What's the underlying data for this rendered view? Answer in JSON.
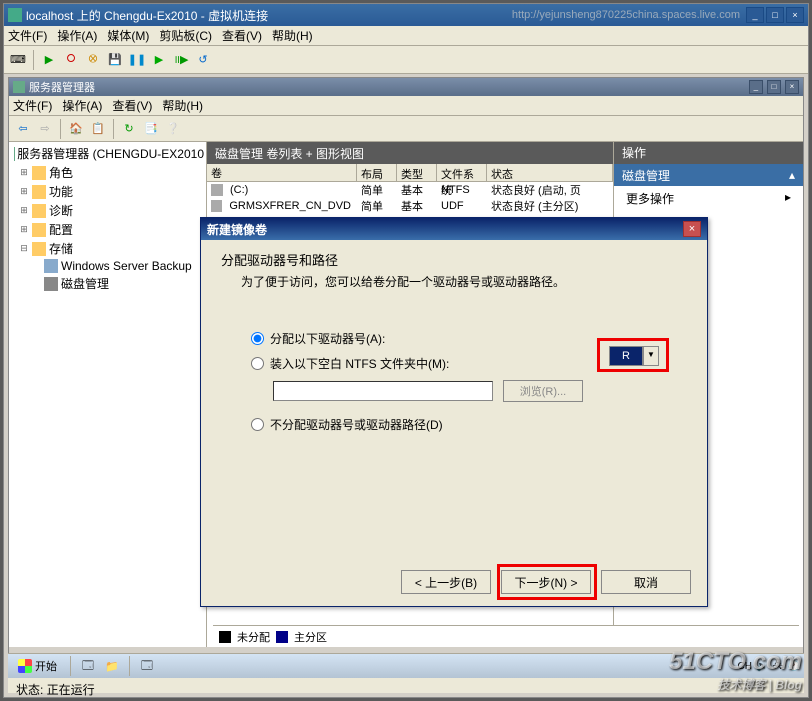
{
  "vm": {
    "title": "localhost 上的 Chengdu-Ex2010 - 虚拟机连接",
    "url": "http://yejunsheng870225china.spaces.live.com",
    "menu": {
      "file": "文件(F)",
      "action": "操作(A)",
      "media": "媒体(M)",
      "clipboard": "剪贴板(C)",
      "view": "查看(V)",
      "help": "帮助(H)"
    }
  },
  "smgr": {
    "title": "服务器管理器",
    "menu": {
      "file": "文件(F)",
      "action": "操作(A)",
      "view": "查看(V)",
      "help": "帮助(H)"
    }
  },
  "tree": {
    "root": "服务器管理器 (CHENGDU-EX2010",
    "roles": "角色",
    "features": "功能",
    "diag": "诊断",
    "config": "配置",
    "storage": "存储",
    "backup": "Windows Server Backup",
    "diskmgmt": "磁盘管理"
  },
  "disk": {
    "header": "磁盘管理   卷列表 + 图形视图",
    "cols": {
      "vol": "卷",
      "layout": "布局",
      "type": "类型",
      "fs": "文件系统",
      "status": "状态"
    },
    "rows": [
      {
        "vol": "(C:)",
        "layout": "简单",
        "type": "基本",
        "fs": "NTFS",
        "status": "状态良好 (启动, 页"
      },
      {
        "vol": "GRMSXFRER_CN_DVD (D:)",
        "layout": "简单",
        "type": "基本",
        "fs": "UDF",
        "status": "状态良好 (主分区)"
      }
    ]
  },
  "actions": {
    "header": "操作",
    "sub": "磁盘管理",
    "more": "更多操作"
  },
  "dialog": {
    "title": "新建镜像卷",
    "heading": "分配驱动器号和路径",
    "subheading": "为了便于访问，您可以给卷分配一个驱动器号或驱动器路径。",
    "opt_assign": "分配以下驱动器号(A):",
    "opt_mount": "装入以下空白 NTFS 文件夹中(M):",
    "opt_none": "不分配驱动器号或驱动器路径(D)",
    "drive": "R",
    "browse": "浏览(R)...",
    "back": "< 上一步(B)",
    "next": "下一步(N) >",
    "cancel": "取消"
  },
  "legend": {
    "unalloc": "未分配",
    "primary": "主分区"
  },
  "taskbar": {
    "start": "开始",
    "lang": "CH",
    "time": ""
  },
  "status": "状态: 正在运行",
  "watermark": {
    "main": "51CTO.com",
    "sub": "技术博客 | Blog"
  }
}
